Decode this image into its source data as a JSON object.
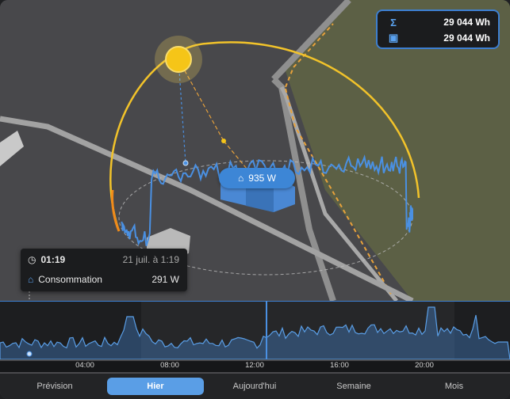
{
  "stats": {
    "total": {
      "icon": "sigma-icon",
      "value": "29 044 Wh"
    },
    "day": {
      "icon": "calendar-icon",
      "value": "29 044 Wh"
    }
  },
  "house_badge": {
    "icon": "home-icon",
    "value": "935 W"
  },
  "tooltip": {
    "time": "01:19",
    "date": "21 juil. à 1:19",
    "label": "Consommation",
    "value": "291 W"
  },
  "timeline": {
    "ticks": [
      "04:00",
      "08:00",
      "12:00",
      "16:00",
      "20:00"
    ]
  },
  "tabs": [
    {
      "label": "Prévision",
      "active": false
    },
    {
      "label": "Hier",
      "active": true
    },
    {
      "label": "Aujourd'hui",
      "active": false
    },
    {
      "label": "Semaine",
      "active": false
    },
    {
      "label": "Mois",
      "active": false
    }
  ],
  "colors": {
    "sun": "#f5c518",
    "series": "#4a90e2",
    "orange_route": "#e8a23b",
    "park": "#5d6148"
  }
}
